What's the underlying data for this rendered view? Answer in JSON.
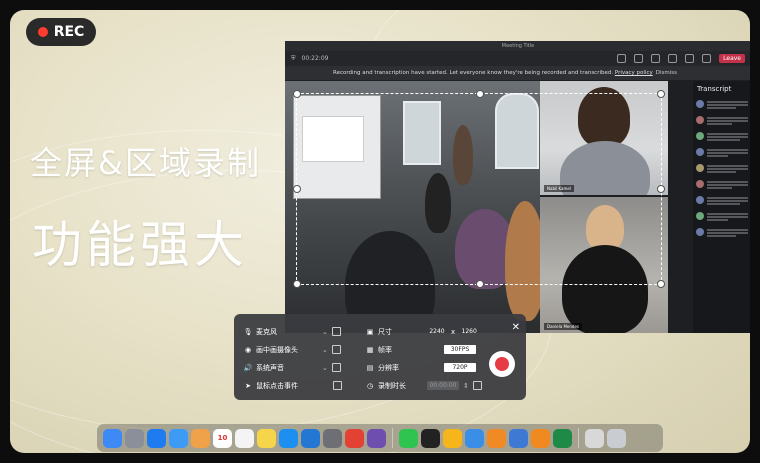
{
  "rec_badge": {
    "label": "REC",
    "dot_color": "#ff3b30"
  },
  "headline": {
    "line1": "全屏&区域录制",
    "line2": "功能强大"
  },
  "meeting": {
    "window_title": "Meeting Title",
    "timer": "00:22:09",
    "banner": "Recording and transcription have started. Let everyone know they're being recorded and transcribed.",
    "banner_link": "Privacy policy",
    "dismiss": "Dismiss",
    "leave": "Leave",
    "participant1": "Nabil Kamel",
    "participant2": "Daniela Mendes",
    "transcript_title": "Transcript"
  },
  "panel": {
    "close_icon": "close-icon",
    "mic_label": "麦克风",
    "camera_label": "画中画摄像头",
    "system_audio_label": "系统声音",
    "mouse_click_label": "鼠标点击事件",
    "size_label": "尺寸",
    "width_value": "2240",
    "times": "x",
    "height_value": "1260",
    "fps_label": "帧率",
    "fps_value": "30FPS",
    "resolution_label": "分辨率",
    "resolution_value": "720P",
    "duration_label": "录制时长",
    "duration_value": "00:00:00",
    "record_color": "#e63a45"
  },
  "dock": {
    "apps": [
      {
        "name": "finder",
        "color": "#3d8af7"
      },
      {
        "name": "launchpad",
        "color": "#8b8f9a"
      },
      {
        "name": "safari",
        "color": "#1e7cf0"
      },
      {
        "name": "mail",
        "color": "#3e9bf5"
      },
      {
        "name": "photos",
        "color": "#f0a24a"
      },
      {
        "name": "calendar",
        "color": "#ffffff",
        "text": "10"
      },
      {
        "name": "reminders",
        "color": "#f4f4f4"
      },
      {
        "name": "notes",
        "color": "#f6d54a"
      },
      {
        "name": "app-store",
        "color": "#1d8ff0"
      },
      {
        "name": "xcode",
        "color": "#2477d2"
      },
      {
        "name": "system-settings",
        "color": "#6d6f74"
      },
      {
        "name": "chrome",
        "color": "#e34133"
      },
      {
        "name": "github",
        "color": "#6e4fb0"
      },
      {
        "name": "wechat",
        "color": "#2ec44f"
      },
      {
        "name": "terminal",
        "color": "#222222"
      },
      {
        "name": "sketch",
        "color": "#f5b51b"
      },
      {
        "name": "network",
        "color": "#3b8ee6"
      },
      {
        "name": "sublime",
        "color": "#f08a24"
      },
      {
        "name": "transmit",
        "color": "#3e7ad3"
      },
      {
        "name": "vlc",
        "color": "#f08a20"
      },
      {
        "name": "excel",
        "color": "#1f8a47"
      },
      {
        "name": "preview",
        "color": "#d8d8d8"
      },
      {
        "name": "trash",
        "color": "#c9ccd0"
      }
    ]
  }
}
